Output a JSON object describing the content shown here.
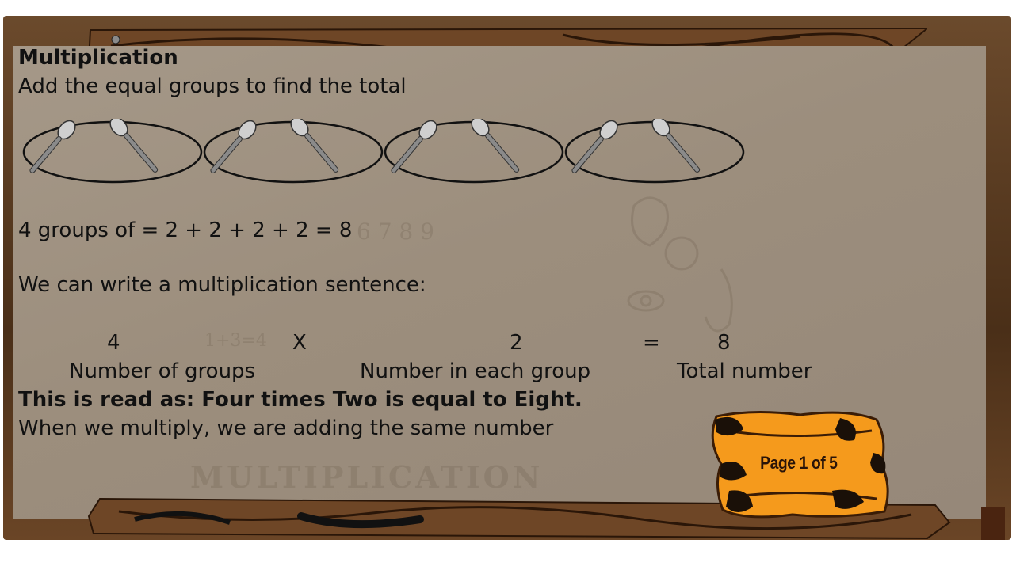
{
  "lesson": {
    "title": "Multiplication",
    "instruction": "Add the equal groups to find the total",
    "groups_line": "4 groups of  = 2 + 2 + 2 + 2 = 8",
    "intro_sentence": "We can write a multiplication sentence:",
    "sentence": {
      "groups_value": "4",
      "times_symbol": "X",
      "per_group_value": "2",
      "equals_symbol": "=",
      "total_value": "8",
      "groups_label": "Number of groups",
      "per_group_label": "Number in each group",
      "total_label": "Total number"
    },
    "read_as": "This is read as: Four  times  Two is equal to Eight.",
    "explanation": "When we multiply, we are adding the same number"
  },
  "groups": {
    "count": 4,
    "items_per_group": 2,
    "item_icon": "spoon-icon"
  },
  "pager": {
    "label": "Page 1 of 5",
    "color": "#f59a1c"
  },
  "background_watermark": {
    "word": "MULTIPLICATION",
    "digits": "6  7  8  9",
    "equation": "1+3=4"
  },
  "colors": {
    "wood": "#5a3a20",
    "board": "#a09282",
    "badge_orange": "#f59a1c",
    "badge_spots": "#1a1008"
  }
}
